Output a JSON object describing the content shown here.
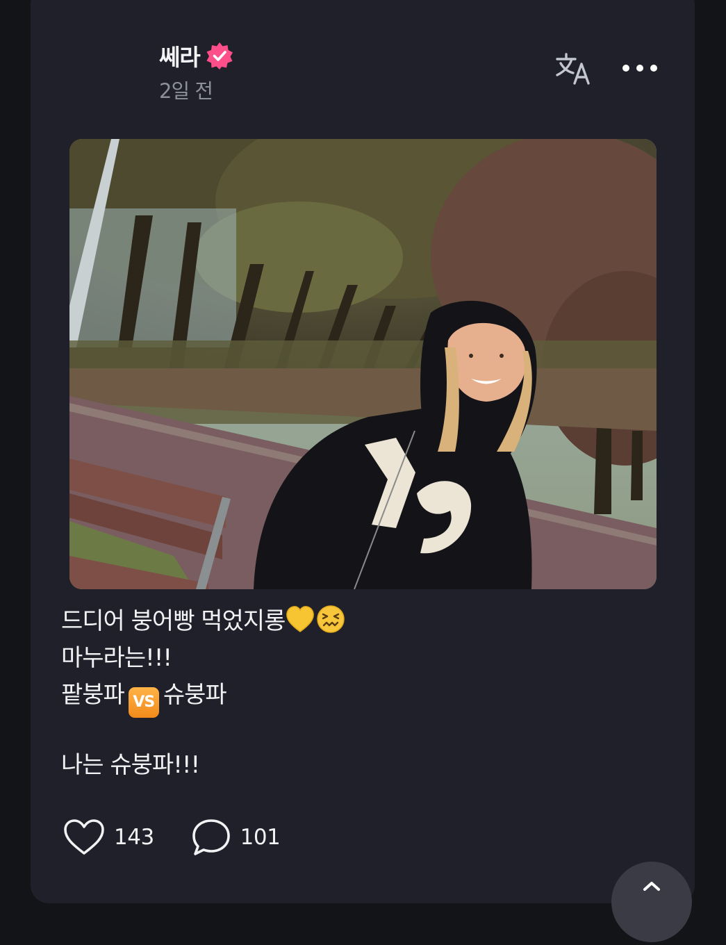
{
  "post": {
    "author": "쎄라",
    "timestamp": "2일 전",
    "verified_icon": "verified-badge-icon",
    "accent_color": "#ff4f8b",
    "caption_lines": [
      "드디어 붕어빵 먹었지롱",
      "마누라는!!!",
      "팥붕파",
      "슈붕파",
      "나는 슈붕파!!!"
    ],
    "vs_badge": "VS"
  },
  "header_actions": {
    "translate_icon": "translate-icon",
    "more_icon": "more-horizontal-icon"
  },
  "stats": {
    "likes": "143",
    "comments": "101"
  }
}
